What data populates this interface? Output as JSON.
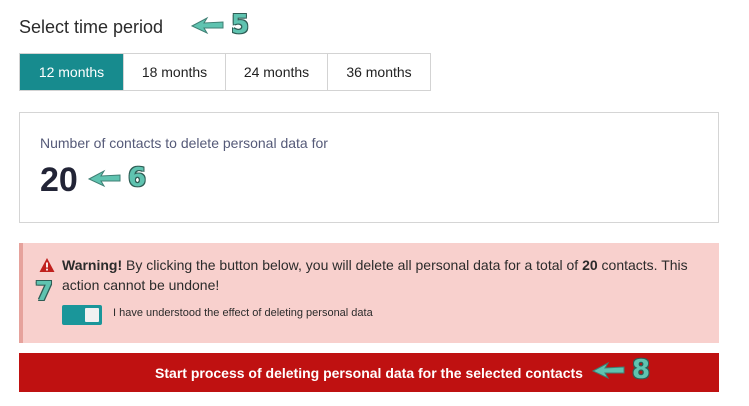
{
  "time_period": {
    "title": "Select time period",
    "tabs": [
      {
        "label": "12 months",
        "active": true
      },
      {
        "label": "18 months",
        "active": false
      },
      {
        "label": "24 months",
        "active": false
      },
      {
        "label": "36 months",
        "active": false
      }
    ]
  },
  "contacts": {
    "label": "Number of contacts to delete personal data for",
    "count": "20"
  },
  "warning": {
    "strong": "Warning!",
    "text_before_count": " By clicking the button below, you will delete all personal data for a total of ",
    "count": "20",
    "text_after_count": " contacts. This action cannot be undone!",
    "toggle_label": "I have understood the effect of deleting personal data",
    "toggle_on": true
  },
  "action": {
    "button_label": "Start process of deleting personal data for the selected contacts"
  },
  "annotations": {
    "five": "5",
    "six": "6",
    "seven": "7",
    "eight": "8"
  },
  "colors": {
    "accent": "#178b8e",
    "warning_bg": "#f8d0cd",
    "danger": "#bf1111",
    "callout": "#5fc3b0"
  },
  "icons": {
    "warning": "warning-triangle-icon",
    "arrow": "arrow-left-icon"
  }
}
